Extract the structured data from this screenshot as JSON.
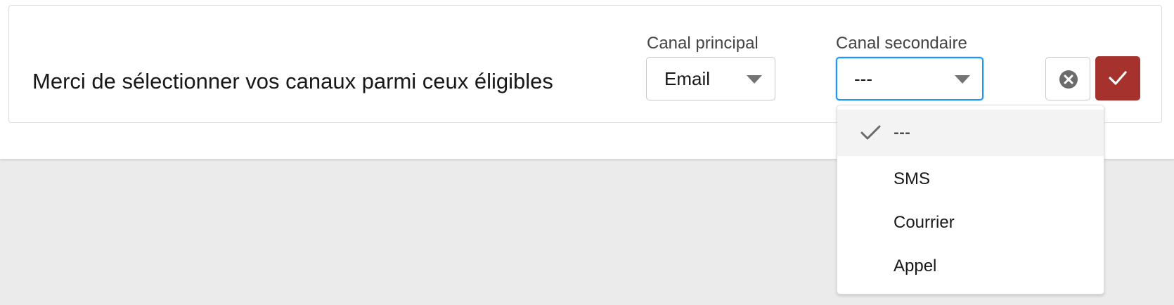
{
  "prompt": "Merci de sélectionner vos canaux parmi ceux éligibles",
  "primary_channel": {
    "label": "Canal principal",
    "value": "Email"
  },
  "secondary_channel": {
    "label": "Canal secondaire",
    "value": "---",
    "options": [
      "---",
      "SMS",
      "Courrier",
      "Appel"
    ]
  },
  "icons": {
    "cancel": "close-circle-icon",
    "confirm": "check-icon",
    "caret": "chevron-down-icon",
    "selected": "check-icon"
  },
  "colors": {
    "confirm_button": "#a5322d",
    "focus_border": "#1b96ff",
    "selected_option_bg": "#f3f3f3"
  }
}
